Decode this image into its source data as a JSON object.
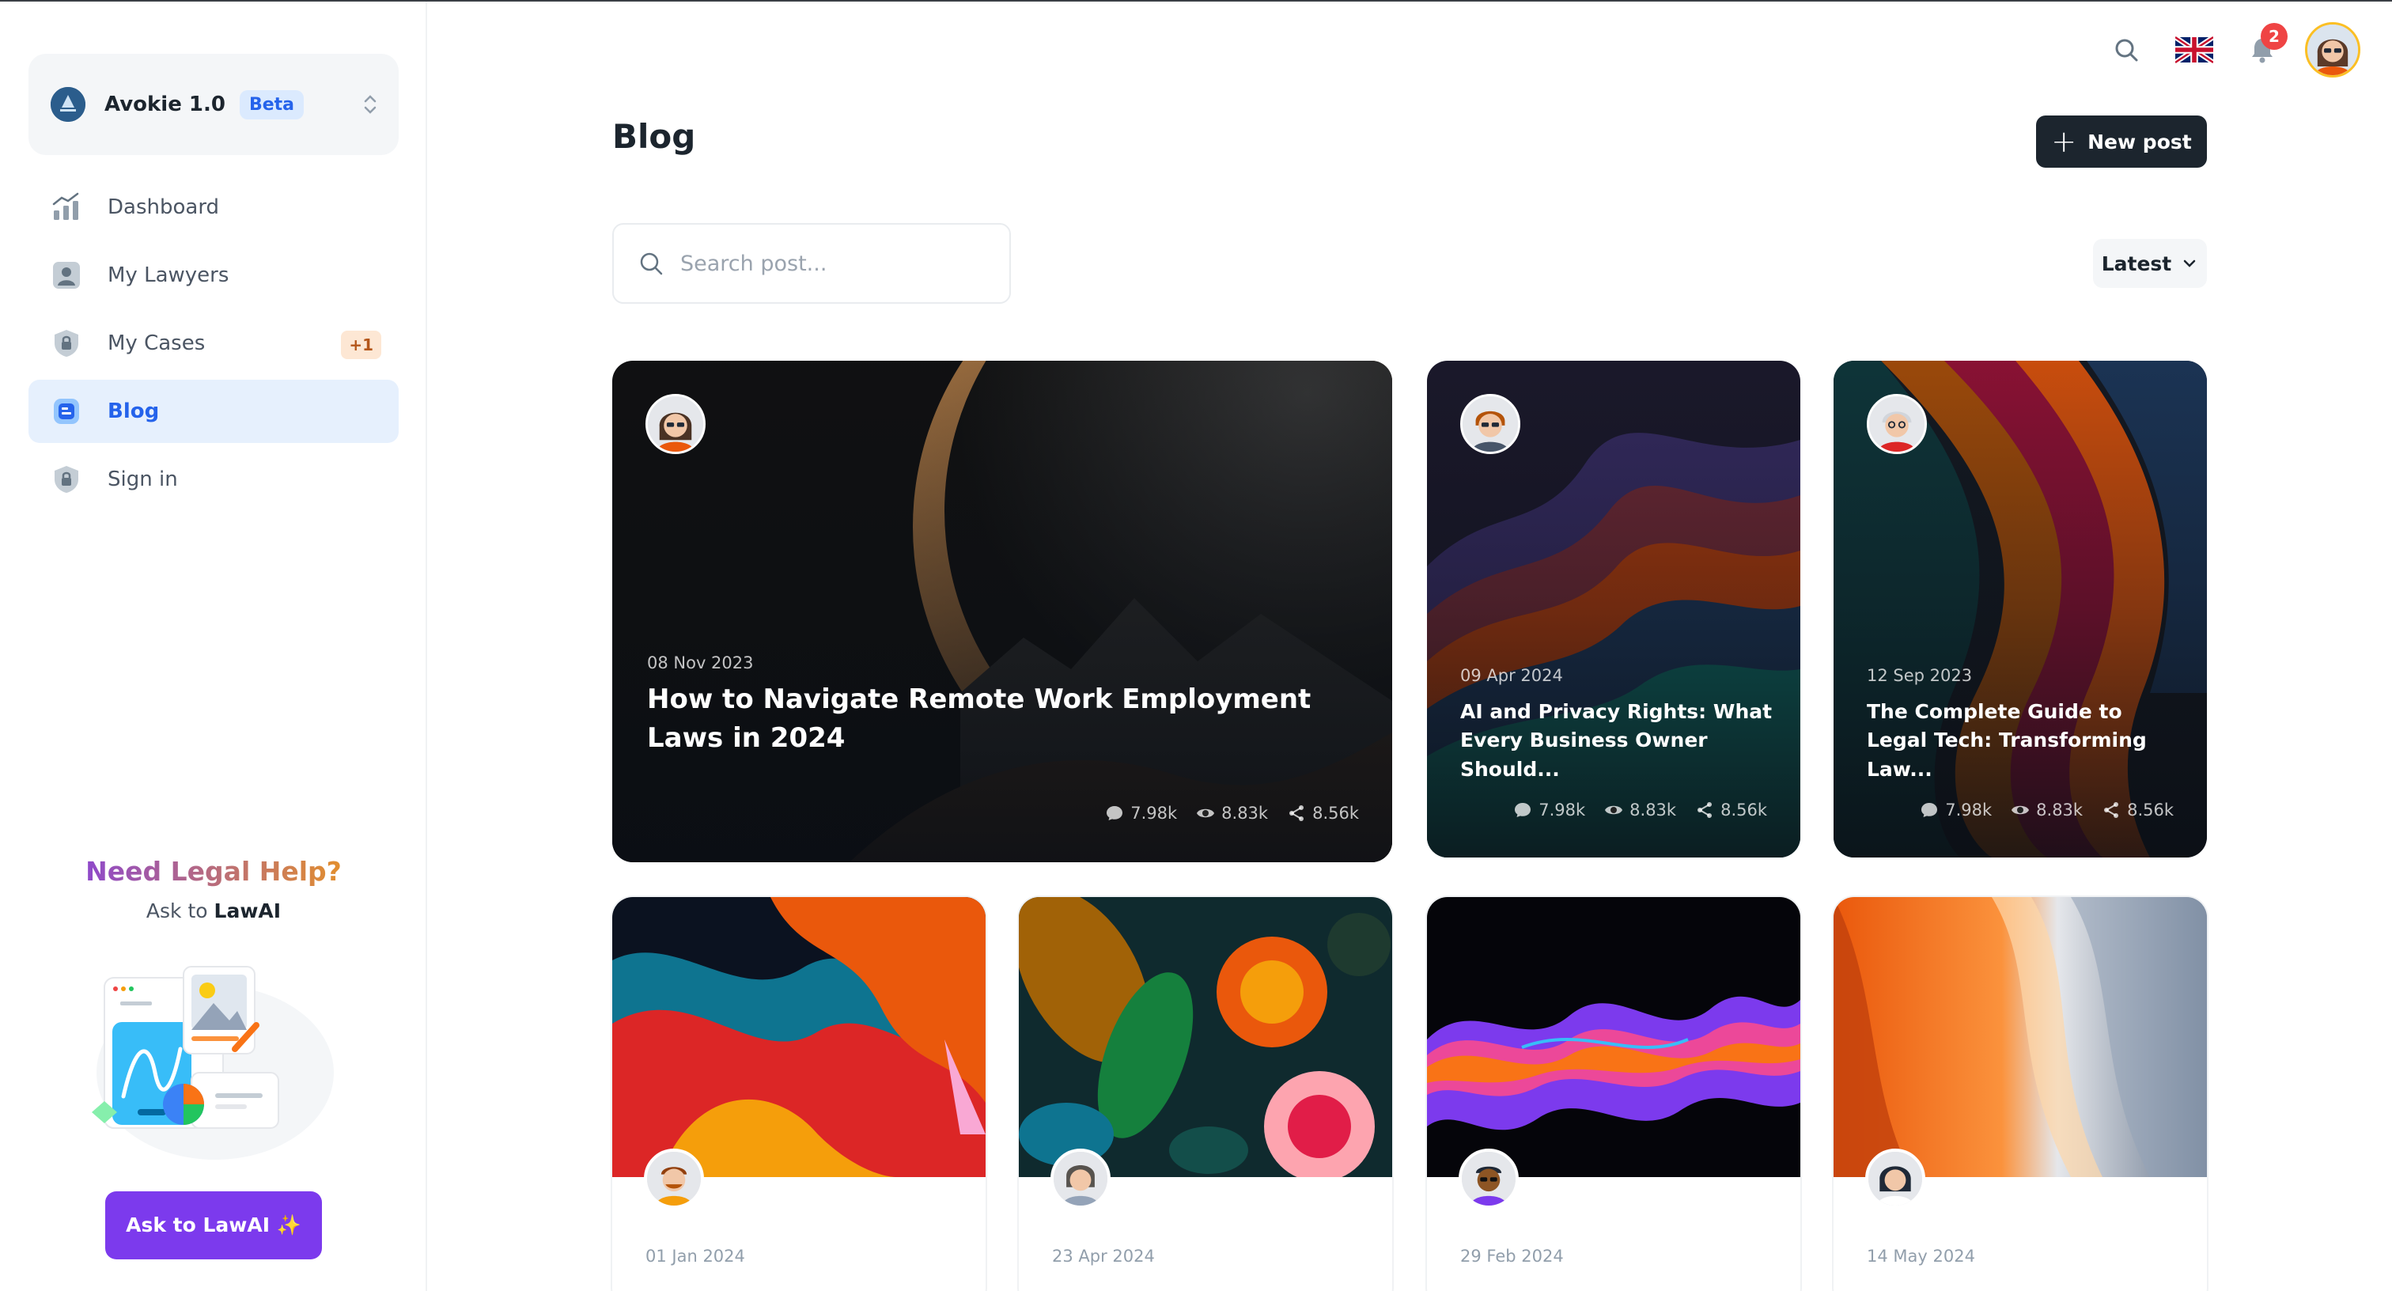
{
  "workspace": {
    "name": "Avokie 1.0",
    "badge": "Beta"
  },
  "nav": [
    {
      "label": "Dashboard",
      "icon": "chart-icon"
    },
    {
      "label": "My Lawyers",
      "icon": "user-icon"
    },
    {
      "label": "My Cases",
      "icon": "lock-icon",
      "badge": "+1"
    },
    {
      "label": "Blog",
      "icon": "blog-icon",
      "active": true
    },
    {
      "label": "Sign in",
      "icon": "lock-icon"
    }
  ],
  "help": {
    "title": "Need Legal Help?",
    "sub_prefix": "Ask to",
    "sub_brand": "LawAI",
    "button": "Ask to LawAI ✨"
  },
  "header": {
    "notifications": "2"
  },
  "page": {
    "title": "Blog",
    "new_post": "New post",
    "search_placeholder": "Search post...",
    "sort": "Latest"
  },
  "featured": [
    {
      "date": "08 Nov 2023",
      "title": "How to Navigate Remote Work Employment Laws in 2024",
      "comments": "7.98k",
      "views": "8.83k",
      "shares": "8.56k"
    },
    {
      "date": "09 Apr 2024",
      "title": "AI and Privacy Rights: What Every Business Owner Should...",
      "comments": "7.98k",
      "views": "8.83k",
      "shares": "8.56k"
    },
    {
      "date": "12 Sep 2023",
      "title": "The Complete Guide to Legal Tech: Transforming Law...",
      "comments": "7.98k",
      "views": "8.83k",
      "shares": "8.56k"
    }
  ],
  "posts": [
    {
      "date": "01 Jan 2024"
    },
    {
      "date": "23 Apr 2024"
    },
    {
      "date": "29 Feb 2024"
    },
    {
      "date": "14 May 2024"
    }
  ],
  "colors": {
    "accent": "#2563eb",
    "primary_dark": "#1c252e",
    "help_purple": "#7c3aed",
    "badge_red": "#ef4444"
  }
}
